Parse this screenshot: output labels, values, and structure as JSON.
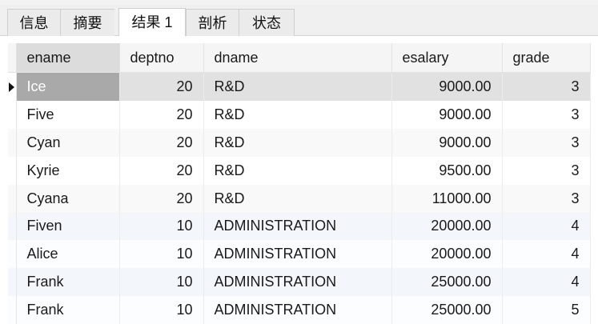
{
  "tabs": [
    {
      "label": "信息",
      "active": false
    },
    {
      "label": "摘要",
      "active": false
    },
    {
      "label": "结果 1",
      "active": true
    },
    {
      "label": "剖析",
      "active": false
    },
    {
      "label": "状态",
      "active": false
    }
  ],
  "grid": {
    "columns": [
      "ename",
      "deptno",
      "dname",
      "esalary",
      "grade"
    ],
    "selected_row_index": 0,
    "rows": [
      {
        "ename": "Ice",
        "deptno": "20",
        "dname": "R&D",
        "esalary": "9000.00",
        "grade": "3"
      },
      {
        "ename": "Five",
        "deptno": "20",
        "dname": "R&D",
        "esalary": "9000.00",
        "grade": "3"
      },
      {
        "ename": "Cyan",
        "deptno": "20",
        "dname": "R&D",
        "esalary": "9000.00",
        "grade": "3"
      },
      {
        "ename": "Kyrie",
        "deptno": "20",
        "dname": "R&D",
        "esalary": "9500.00",
        "grade": "3"
      },
      {
        "ename": "Cyana",
        "deptno": "20",
        "dname": "R&D",
        "esalary": "11000.00",
        "grade": "3"
      },
      {
        "ename": "Fiven",
        "deptno": "10",
        "dname": "ADMINISTRATION",
        "esalary": "20000.00",
        "grade": "4"
      },
      {
        "ename": "Alice",
        "deptno": "10",
        "dname": "ADMINISTRATION",
        "esalary": "20000.00",
        "grade": "4"
      },
      {
        "ename": "Frank",
        "deptno": "10",
        "dname": "ADMINISTRATION",
        "esalary": "25000.00",
        "grade": "4"
      },
      {
        "ename": "Frank",
        "deptno": "10",
        "dname": "ADMINISTRATION",
        "esalary": "25000.00",
        "grade": "5"
      }
    ]
  },
  "colors": {
    "selected_row": "#e1e1e1",
    "selected_cell": "#a9a9a9",
    "sorted_header": "#dcdcdc"
  }
}
